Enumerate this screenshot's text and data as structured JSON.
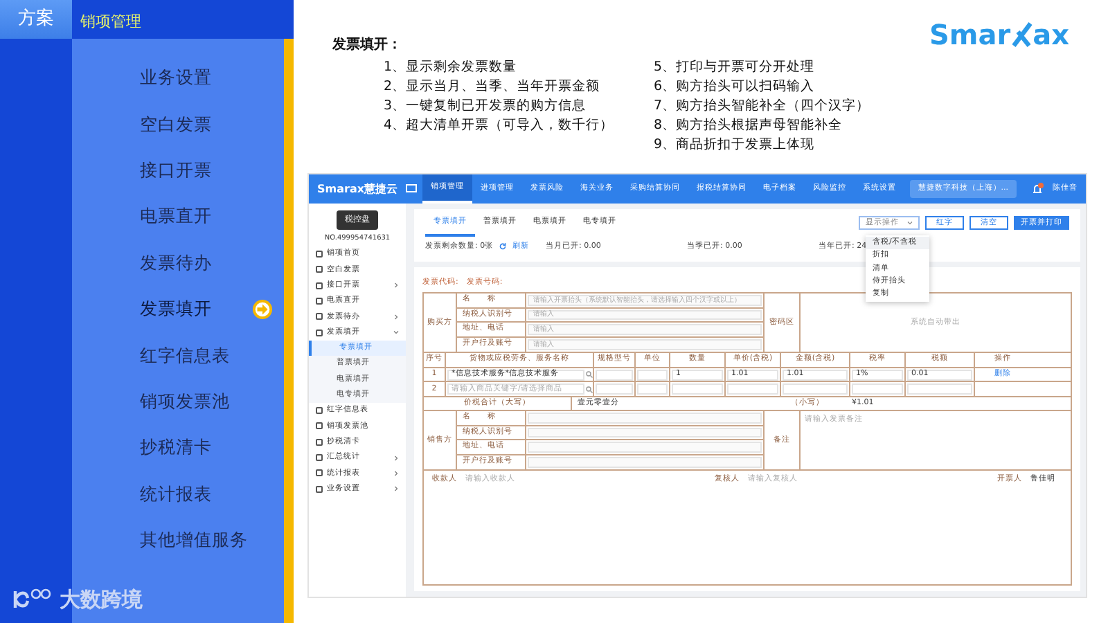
{
  "side": {
    "tab": "方案",
    "header": "销项管理",
    "items": [
      {
        "label": "业务设置",
        "selected": false
      },
      {
        "label": "空白发票",
        "selected": false
      },
      {
        "label": "接口开票",
        "selected": false
      },
      {
        "label": "电票直开",
        "selected": false
      },
      {
        "label": "发票待办",
        "selected": false
      },
      {
        "label": "发票填开",
        "selected": true
      },
      {
        "label": "红字信息表",
        "selected": false
      },
      {
        "label": "销项发票池",
        "selected": false
      },
      {
        "label": "抄税清卡",
        "selected": false
      },
      {
        "label": "统计报表",
        "selected": false
      },
      {
        "label": "其他增值服务",
        "selected": false
      }
    ],
    "brand": "大数跨境"
  },
  "slide": {
    "title": "发票填开：",
    "logo": [
      "Smar",
      "ax"
    ],
    "columns": [
      [
        "1、显示剩余发票数量",
        "2、显示当月、当季、当年开票金额",
        "3、一键复制已开发票的购方信息",
        "4、超大清单开票（可导入，数千行）"
      ],
      [
        "5、打印与开票可分开处理",
        "6、购方抬头可以扫码输入",
        "7、购方抬头智能补全（四个汉字）",
        "8、购方抬头根据声母智能补全",
        "9、商品折扣于发票上体现"
      ]
    ]
  },
  "app": {
    "logo": [
      "Smar",
      "ax慧捷云"
    ],
    "nav": [
      {
        "label": "销项管理",
        "selected": true
      },
      {
        "label": "进项管理",
        "selected": false
      },
      {
        "label": "发票风险",
        "selected": false
      },
      {
        "label": "海关业务",
        "selected": false
      },
      {
        "label": "采购结算协同",
        "selected": false
      },
      {
        "label": "报税结算协同",
        "selected": false
      },
      {
        "label": "电子档案",
        "selected": false
      },
      {
        "label": "风险监控",
        "selected": false
      },
      {
        "label": "系统设置",
        "selected": false
      }
    ],
    "company": "慧捷数字科技（上海）...",
    "user": "陈佳音",
    "device": {
      "label": "税控盘",
      "number": "NO.499954741631"
    },
    "menu": [
      {
        "label": "销项首页",
        "has_submenu": false,
        "expanded": false
      },
      {
        "label": "空白发票",
        "has_submenu": false,
        "expanded": false
      },
      {
        "label": "接口开票",
        "has_submenu": true,
        "expanded": false
      },
      {
        "label": "电票直开",
        "has_submenu": false,
        "expanded": false
      },
      {
        "label": "发票待办",
        "has_submenu": true,
        "expanded": false
      },
      {
        "label": "发票填开",
        "has_submenu": true,
        "expanded": true,
        "children": [
          {
            "label": "专票填开",
            "selected": true
          },
          {
            "label": "普票填开",
            "selected": false
          },
          {
            "label": "电票填开",
            "selected": false
          },
          {
            "label": "电专填开",
            "selected": false
          }
        ]
      },
      {
        "label": "红字信息表",
        "has_submenu": false,
        "expanded": false
      },
      {
        "label": "销项发票池",
        "has_submenu": false,
        "expanded": false
      },
      {
        "label": "抄税清卡",
        "has_submenu": false,
        "expanded": false
      },
      {
        "label": "汇总统计",
        "has_submenu": true,
        "expanded": false
      },
      {
        "label": "统计报表",
        "has_submenu": true,
        "expanded": false
      },
      {
        "label": "业务设置",
        "has_submenu": true,
        "expanded": false
      }
    ],
    "tabs": [
      {
        "label": "专票填开",
        "selected": true
      },
      {
        "label": "普票填开",
        "selected": false
      },
      {
        "label": "电票填开",
        "selected": false
      },
      {
        "label": "电专填开",
        "selected": false
      }
    ],
    "operation_select": "显示操作",
    "buttons": [
      "红字",
      "清空"
    ],
    "primary_button": "开票并打印",
    "dropdown": [
      {
        "label": "含税/不含税",
        "selected": true
      },
      {
        "label": "折扣",
        "selected": false
      },
      {
        "label": "清单",
        "selected": false
      },
      {
        "label": "侍开抬头",
        "selected": false
      },
      {
        "label": "复制",
        "selected": false
      }
    ],
    "remaining": "发票剩余数量: 0张",
    "refresh": "刷新",
    "stats": [
      "当月已开: 0.00",
      "当季已开: 0.00",
      "当年已开: 24"
    ],
    "invoice": {
      "code_label": "发票代码:",
      "number_label": "发票号码:",
      "buyer": {
        "title": "购买方",
        "fields": [
          {
            "label": "名　　称",
            "placeholder": "请输入开票抬头（系统默认智能抬头，请选择输入四个汉字或以上）"
          },
          {
            "label": "纳税人识别号",
            "placeholder": "请输入"
          },
          {
            "label": "地址、电话",
            "placeholder": "请输入"
          },
          {
            "label": "开户行及账号",
            "placeholder": "请输入"
          }
        ]
      },
      "cipher": {
        "label": "密码区",
        "text": "系统自动带出"
      },
      "columns": [
        "序号",
        "货物或应税劳务、服务名称",
        "规格型号",
        "单位",
        "数量",
        "单价(含税)",
        "金额(含税)",
        "税率",
        "税额",
        "操作"
      ],
      "rows": [
        {
          "kind": "item",
          "no": "1",
          "name": "*信息技术服务*信息技术服务",
          "qty": "1",
          "price": "1.01",
          "amount": "1.01",
          "rate": "1%",
          "tax": "0.01",
          "action": "删除"
        },
        {
          "kind": "blank",
          "no": "2",
          "placeholder": "请输入商品关键字/请选择商品"
        }
      ],
      "total": {
        "label": "价税合计（大写）",
        "words": "壹元零壹分",
        "small_label": "（小写）",
        "value": "¥1.01"
      },
      "seller": {
        "title": "销售方",
        "fields": [
          "名　　称",
          "纳税人识别号",
          "地址、电话",
          "开户行及账号"
        ]
      },
      "remark": {
        "label": "备注",
        "placeholder": "请输入发票备注"
      },
      "signers": [
        {
          "label": "收款人",
          "placeholder": "请输入收款人"
        },
        {
          "label": "复核人",
          "placeholder": "请输入复核人"
        },
        {
          "label": "开票人",
          "value": "鲁佳明"
        }
      ]
    }
  }
}
